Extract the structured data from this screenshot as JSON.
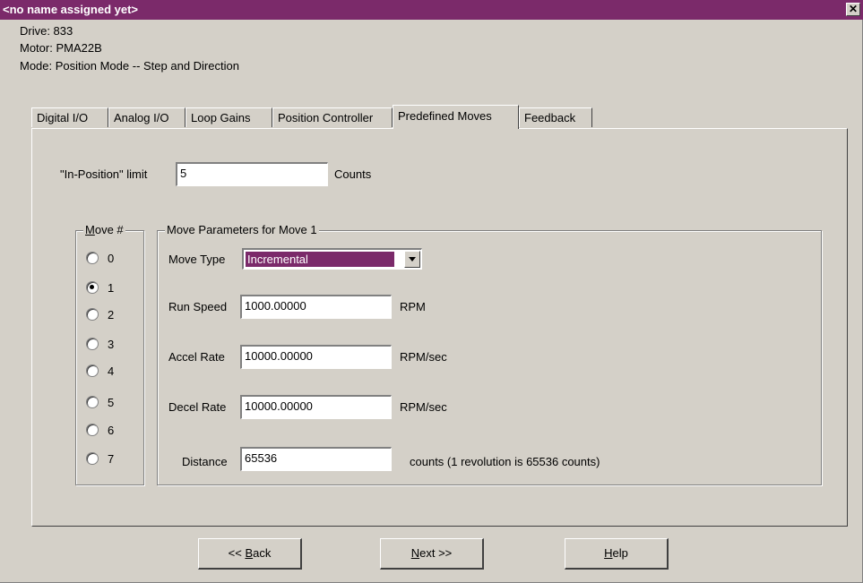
{
  "window": {
    "title": "<no name assigned yet>",
    "close_glyph": "✕"
  },
  "info": {
    "drive": "Drive: 833",
    "motor": "Motor: PMA22B",
    "mode": "Mode: Position Mode -- Step and Direction"
  },
  "tabs": [
    {
      "label": "Digital I/O"
    },
    {
      "label": "Analog I/O"
    },
    {
      "label": "Loop Gains"
    },
    {
      "label": "Position Controller"
    },
    {
      "label": "Predefined Moves",
      "active": true
    },
    {
      "label": "Feedback"
    }
  ],
  "in_position": {
    "label": "\"In-Position\" limit",
    "value": "5",
    "unit": "Counts"
  },
  "move_group": {
    "title_first": "M",
    "title_rest": "ove #",
    "options": [
      "0",
      "1",
      "2",
      "3",
      "4",
      "5",
      "6",
      "7"
    ],
    "selected": "1"
  },
  "params": {
    "title": "Move Parameters for Move 1",
    "move_type_label": "Move Type",
    "move_type_value": "Incremental",
    "run_speed_label": "Run Speed",
    "run_speed_value": "1000.00000",
    "run_speed_unit": "RPM",
    "accel_label": "Accel Rate",
    "accel_value": "10000.00000",
    "accel_unit": "RPM/sec",
    "decel_label": "Decel Rate",
    "decel_value": "10000.00000",
    "decel_unit": "RPM/sec",
    "distance_label": "Distance",
    "distance_value": "65536",
    "distance_unit": "counts (1 revolution is 65536 counts)"
  },
  "buttons": {
    "back_prefix": "<< ",
    "back_key": "B",
    "back_rest": "ack",
    "next_key": "N",
    "next_rest": "ext >>",
    "help_key": "H",
    "help_rest": "elp"
  },
  "colors": {
    "title_bg": "#7b2a6a",
    "face": "#d4d0c8",
    "selection": "#7b2a6a"
  },
  "icons": [
    "close-icon",
    "radio-icon",
    "dropdown-arrow-icon"
  ]
}
